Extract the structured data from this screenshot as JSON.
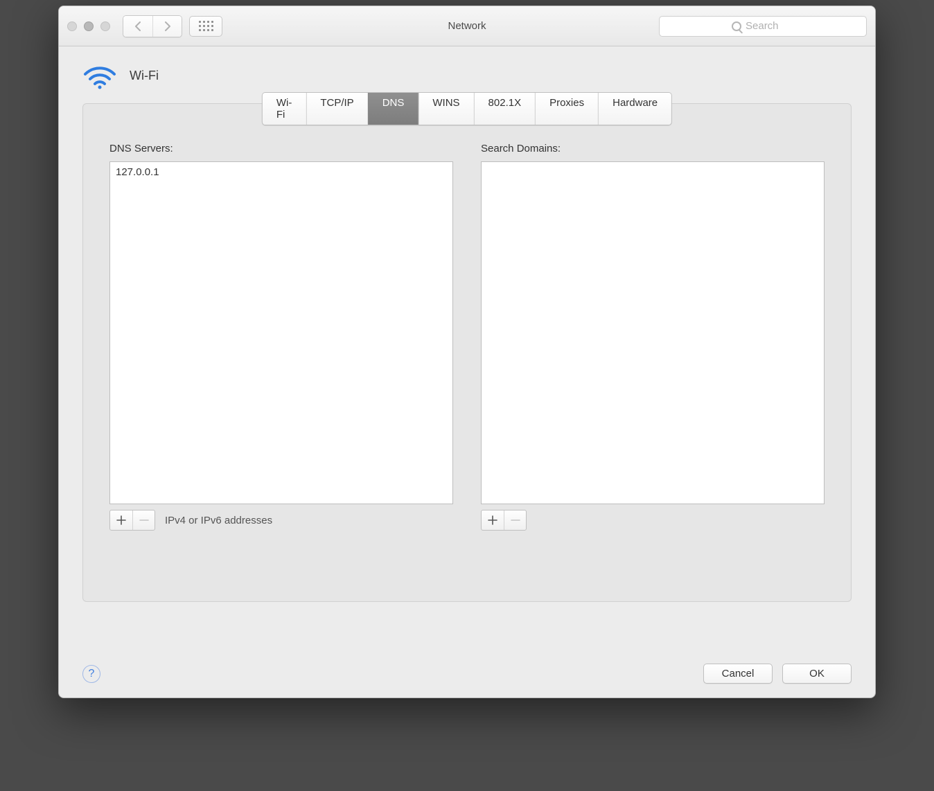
{
  "window": {
    "title": "Network"
  },
  "toolbar": {
    "search_placeholder": "Search"
  },
  "interface": {
    "name": "Wi-Fi"
  },
  "tabs": [
    {
      "label": "Wi-Fi",
      "active": false
    },
    {
      "label": "TCP/IP",
      "active": false
    },
    {
      "label": "DNS",
      "active": true
    },
    {
      "label": "WINS",
      "active": false
    },
    {
      "label": "802.1X",
      "active": false
    },
    {
      "label": "Proxies",
      "active": false
    },
    {
      "label": "Hardware",
      "active": false
    }
  ],
  "dns": {
    "servers_label": "DNS Servers:",
    "servers": [
      "127.0.0.1"
    ],
    "hint": "IPv4 or IPv6 addresses",
    "search_domains_label": "Search Domains:",
    "search_domains": []
  },
  "buttons": {
    "cancel": "Cancel",
    "ok": "OK"
  }
}
